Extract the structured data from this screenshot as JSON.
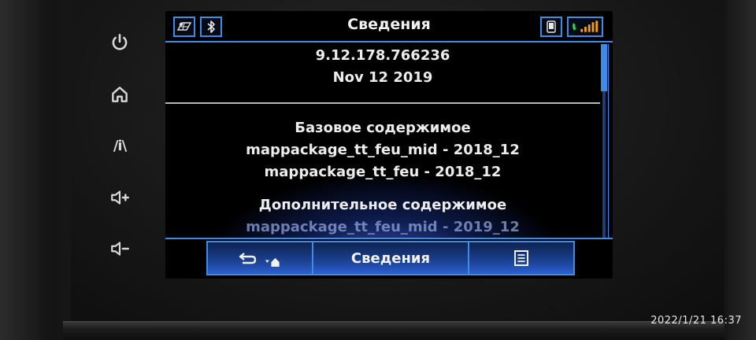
{
  "status_bar": {
    "title": "Сведения",
    "left_icons": [
      "navigation-map-icon",
      "bluetooth-icon"
    ],
    "right_icons": [
      "phone-icon",
      "signal-icon"
    ]
  },
  "content": {
    "version": "9.12.178.766236",
    "date": "Nov 12 2019",
    "base_heading": "Базовое содержимое",
    "base_items": [
      "mappackage_tt_feu_mid - 2018_12",
      "mappackage_tt_feu - 2018_12"
    ],
    "extra_heading": "Дополнительное содержимое",
    "extra_items": [
      "mappackage_tt_feu_mid - 2019_12"
    ]
  },
  "bottom_bar": {
    "back_icon": "back-arrow-icon",
    "home_icon": "home-icon",
    "center_label": "Сведения",
    "menu_icon": "menu-list-icon"
  },
  "side_buttons": [
    {
      "icon": "power-icon"
    },
    {
      "icon": "home-icon"
    },
    {
      "icon": "navigation-icon",
      "label": "/i\\"
    },
    {
      "icon": "volume-up-icon",
      "label": "◁+"
    },
    {
      "icon": "volume-down-icon",
      "label": "◁−"
    }
  ],
  "photo_timestamp": "2022/1/21  16:37",
  "colors": {
    "accent": "#3f8ce8",
    "button_gradient_bottom": "#2b5fd1",
    "text": "#ececec"
  }
}
